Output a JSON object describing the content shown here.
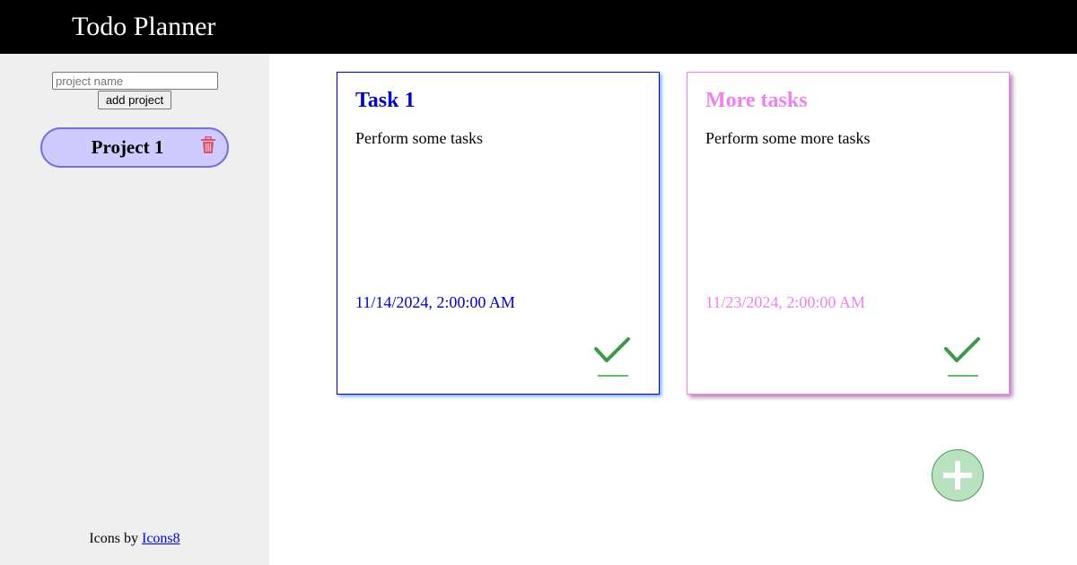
{
  "header": {
    "title": "Todo Planner"
  },
  "sidebar": {
    "project_input_placeholder": "project name",
    "add_project_label": "add project",
    "projects": [
      {
        "label": "Project 1"
      }
    ],
    "attribution_prefix": "Icons by ",
    "attribution_link": "Icons8"
  },
  "tasks": [
    {
      "title": "Task 1",
      "description": "Perform some tasks",
      "due": "11/14/2024, 2:00:00 AM",
      "color": "#0000cc"
    },
    {
      "title": "More tasks",
      "description": "Perform some more tasks",
      "due": "11/23/2024, 2:00:00 AM",
      "color": "#ee82ee"
    }
  ],
  "icons": {
    "delete": "trash-icon",
    "complete": "checkmark-icon",
    "add_task": "plus-icon"
  },
  "colors": {
    "header_bg": "#000000",
    "sidebar_bg": "#efefef",
    "project_bg": "#d0cbff",
    "project_border": "#7070e0",
    "check_green": "#3c9a4a"
  }
}
